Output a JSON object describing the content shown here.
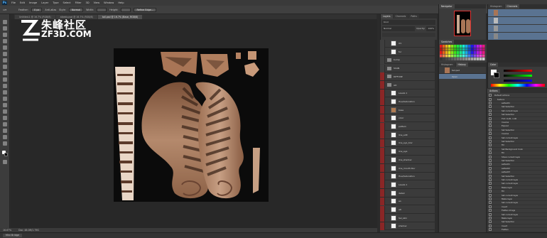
{
  "app": {
    "logo": "Ps",
    "watermark_cn": "朱峰社区",
    "watermark_en": "ZF3D.COM"
  },
  "menubar": {
    "items": [
      "File",
      "Edit",
      "Image",
      "Layer",
      "Type",
      "Select",
      "Filter",
      "3D",
      "View",
      "Window",
      "Help"
    ]
  },
  "options": {
    "feather_label": "Feather:",
    "feather_value": "0 px",
    "antialias": "Anti-alias",
    "style_label": "Style:",
    "style_value": "Normal",
    "width_label": "Width:",
    "height_label": "Height:",
    "refine": "Refine Edge...",
    "workspace": "Essentials"
  },
  "tabs": [
    {
      "label": "Untitled-1 @ 16.7% (RGB/8)",
      "active": false
    },
    {
      "label": "albedo.psd @ 16.7% (RGB/8)",
      "active": false
    },
    {
      "label": "tail.psd @ 16.7% (Base, RGB/8)",
      "active": true
    }
  ],
  "status": {
    "zoom": "16.67%",
    "doc": "Doc: 48.0M/1.79G"
  },
  "bottom": {
    "label": "Mini Bridge"
  },
  "panels": {
    "layers_tabs": [
      "Layers",
      "Channels",
      "Paths"
    ],
    "kind_label": "Kind",
    "blend_label": "Normal",
    "opacity_label": "Opacity:",
    "opacity_value": "100%",
    "navigator_tab": "Navigator",
    "histogram_tab": "Histogram",
    "channels_tab": "Channels",
    "swatches_tab": "Swatches",
    "history_tab": "History",
    "color_tab": "Color",
    "actions_tab": "Actions",
    "history_items": [
      "tail.psd",
      "Open"
    ]
  },
  "layers": [
    {
      "name": "UV",
      "type": "layer",
      "red": false
    },
    {
      "name": "fur",
      "type": "layer",
      "red": false
    },
    {
      "name": "bump",
      "type": "folder",
      "red": false
    },
    {
      "name": "SCAN",
      "type": "folder",
      "red": false
    },
    {
      "name": "DIFFUSE",
      "type": "folder",
      "red": true
    },
    {
      "name": "AO",
      "type": "folder",
      "red": true
    },
    {
      "name": "Levels 1",
      "type": "layer",
      "red": true
    },
    {
      "name": "Hue/Saturation",
      "type": "layer",
      "red": true
    },
    {
      "name": "base",
      "type": "tan",
      "red": true
    },
    {
      "name": "color",
      "type": "layer",
      "red": true
    },
    {
      "name": "pattern",
      "type": "layer",
      "red": true
    },
    {
      "name": "line_edit",
      "type": "layer",
      "red": true
    },
    {
      "name": "line_eye_blur",
      "type": "layer",
      "red": true
    },
    {
      "name": "line_eye",
      "type": "layer",
      "red": true
    },
    {
      "name": "line_shadow",
      "type": "layer",
      "red": true
    },
    {
      "name": "line_mouth blur",
      "type": "layer",
      "red": true
    },
    {
      "name": "Hue/Saturation",
      "type": "layer",
      "red": true
    },
    {
      "name": "Levels 1",
      "type": "layer",
      "red": true
    },
    {
      "name": "detail",
      "type": "layer",
      "red": true
    },
    {
      "name": "ao",
      "type": "layer",
      "red": true
    },
    {
      "name": "alt",
      "type": "layer",
      "red": true
    },
    {
      "name": "Sel_skin",
      "type": "layer",
      "red": true
    },
    {
      "name": "shadow",
      "type": "layer",
      "red": true
    }
  ],
  "actions": [
    "Default Actions",
    "texture",
    "seltex01",
    "Set Selection",
    "Set current layer",
    "Set Selection",
    "Tint: 6.20, 1.00",
    "Inverse",
    "Expand",
    "Set Selection",
    "Inverse",
    "Set current layer",
    "Set Selection",
    "Fill",
    "Set Background Color",
    "Fill",
    "Show current layer",
    "Set Selection",
    "seltex01",
    "seltex02",
    "seltex03",
    "Set Selection",
    "Set current layer",
    "Set current layer",
    "Make layer",
    "Fill",
    "Set current layer",
    "Make layer",
    "Set current layer",
    "Invert",
    "Flatten Image",
    "Set current layer",
    "Make layer",
    "Set Selection",
    "Invert",
    "Flatten"
  ],
  "colors": {
    "accent_red": "#8a2626",
    "selection": "#5a7391",
    "skin": "#b07b52"
  }
}
